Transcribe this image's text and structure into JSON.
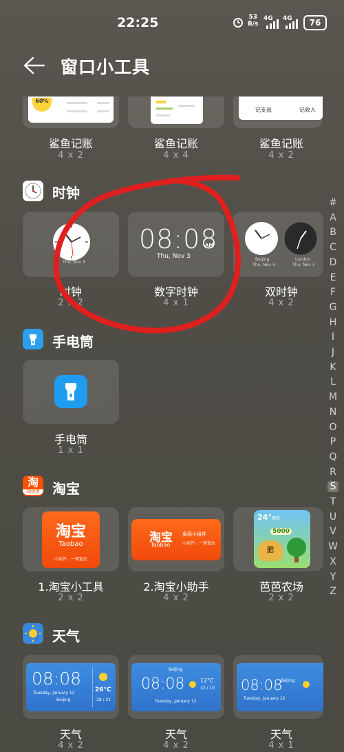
{
  "status": {
    "time": "22:25",
    "net_speed": "53",
    "net_unit": "B/s",
    "signal1": "4G",
    "signal2": "4G",
    "battery": "76"
  },
  "header": {
    "title": "窗口小工具"
  },
  "shark": {
    "items": [
      {
        "label": "鲨鱼记账",
        "size": "4 x 2"
      },
      {
        "label": "鲨鱼记账",
        "size": "4 x 4"
      },
      {
        "label": "鲨鱼记账",
        "size": "4 x 2"
      }
    ],
    "preview_pct": "60%",
    "preview_btn1": "记支出",
    "preview_btn2": "记收入"
  },
  "clock": {
    "section": "时钟",
    "items": [
      {
        "label": "时钟",
        "size": "2 x 2"
      },
      {
        "label": "数字时钟",
        "size": "4 x 1"
      },
      {
        "label": "双时钟",
        "size": "4 x 2"
      }
    ],
    "digital_time": "08:08",
    "digital_ampm": "AM",
    "digital_date": "Thu, Nov 3",
    "analog_date": "Thu, Nov 3",
    "city1": "Beijing",
    "city2": "London",
    "city1_date": "Thu, Nov 3",
    "city2_date": "Thu, Nov 3"
  },
  "flashlight": {
    "section": "手电筒",
    "item": {
      "label": "手电筒",
      "size": "1 x 1"
    }
  },
  "taobao": {
    "section": "淘宝",
    "icon_text": "淘",
    "icon_sub": "38大促",
    "items": [
      {
        "label": "1.淘宝小工具",
        "size": "2 x 2"
      },
      {
        "label": "2.淘宝小助手",
        "size": "4 x 2"
      },
      {
        "label": "芭芭农场",
        "size": "2 x 2"
      }
    ],
    "logo_cn": "淘宝",
    "logo_en": "Taobao",
    "tagline1": "小组件，一键直达",
    "tagline2": "桌面小组件",
    "farm_temp": "24°",
    "farm_weather": "晴天",
    "farm_score": "5000",
    "farm_bag": "肥"
  },
  "weather": {
    "section": "天气",
    "items": [
      {
        "label": "天气",
        "size": "4 x 2"
      },
      {
        "label": "天气",
        "size": "4 x 2"
      },
      {
        "label": "天气",
        "size": "4 x 1"
      }
    ],
    "time": "08:08",
    "date": "Tuesday, January 12",
    "city": "Beijing",
    "temp1": "26°C",
    "range1": "28 / 21",
    "temp2": "12°C",
    "range2": "12 / 10"
  },
  "index_letters": [
    "#",
    "A",
    "B",
    "C",
    "D",
    "E",
    "F",
    "G",
    "H",
    "I",
    "J",
    "K",
    "L",
    "M",
    "N",
    "O",
    "P",
    "Q",
    "R",
    "S",
    "T",
    "U",
    "V",
    "W",
    "X",
    "Y",
    "Z"
  ],
  "index_active": "S",
  "colors": {
    "annotation": "#e0201e",
    "taobao": "#ff5000",
    "weather_blue": "#3a86dd"
  }
}
